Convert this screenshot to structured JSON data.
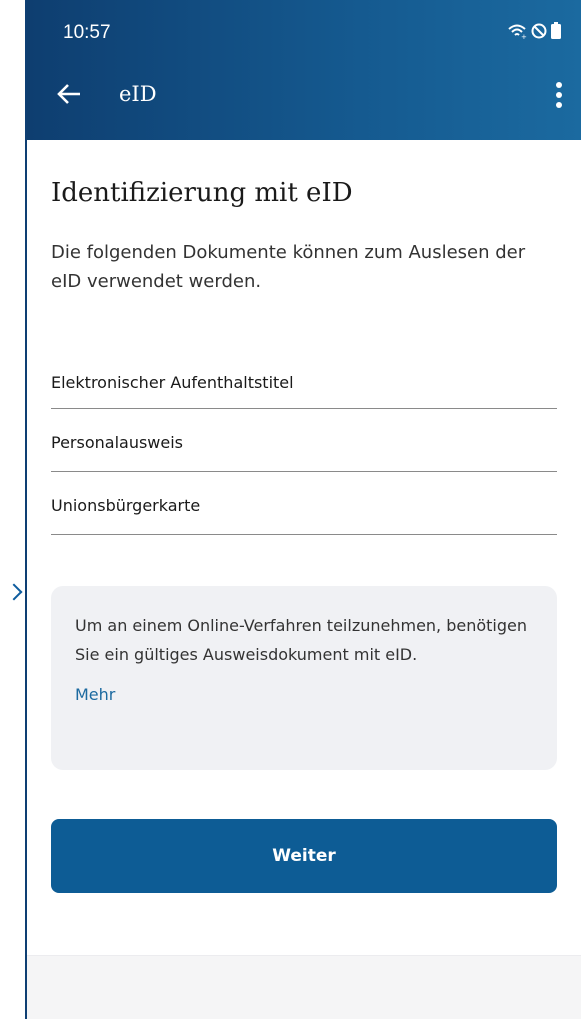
{
  "status_bar": {
    "time": "10:57",
    "icons": [
      "wifi-calling-icon",
      "do-not-disturb-icon",
      "battery-icon"
    ]
  },
  "app_bar": {
    "back_icon": "arrow-left-icon",
    "title": "eID",
    "menu_icon": "more-vertical-icon"
  },
  "main": {
    "heading": "Identifizierung mit eID",
    "intro": "Die folgenden Dokumente können zum Auslesen der eID verwendet werden.",
    "documents": [
      "Elektronischer Aufenthaltstitel",
      "Personalausweis",
      "Unionsbürgerkarte"
    ],
    "info_box": {
      "text": "Um an einem Online-Verfahren teilzunehmen, benötigen Sie ein gültiges Ausweisdokument mit eID.",
      "link": "Mehr"
    },
    "primary_button": "Weiter"
  },
  "colors": {
    "app_bar": "#0e3e70",
    "primary": "#0d5c95",
    "link": "#1c6aa0",
    "info_box_bg": "#f0f1f4"
  }
}
